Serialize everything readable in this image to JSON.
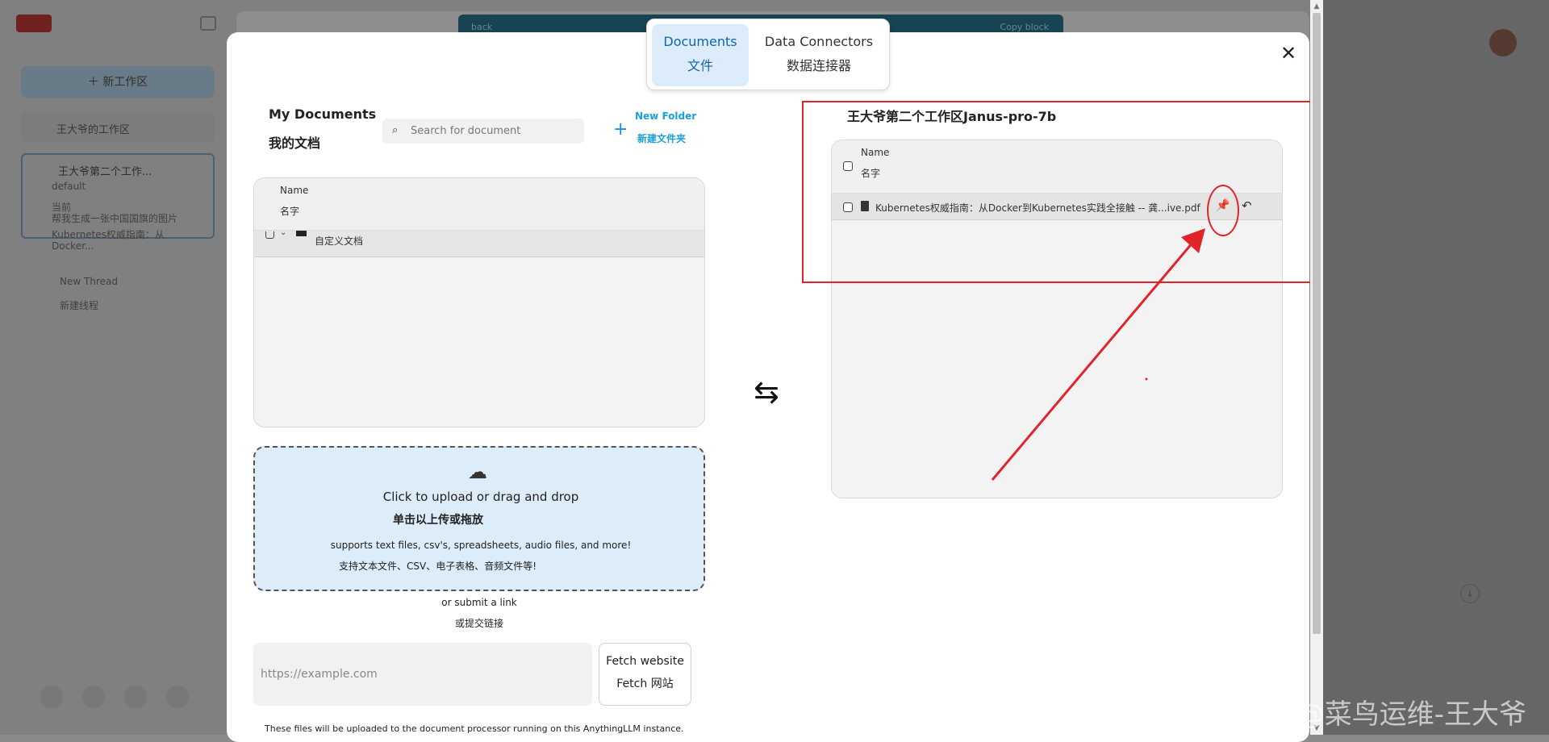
{
  "background_app": {
    "new_workspace": "新工作区",
    "workspace_1": "王大爷的工作区",
    "workspace_2": "王大爷第二个工作...",
    "threads": [
      "default",
      "当前",
      "帮我生成一张中国国旗的图片",
      "Kubernetes权威指南：从Docker..."
    ],
    "new_thread_en": "New Thread",
    "new_thread_zh": "新建线程",
    "top_left": "back",
    "top_right": "Copy block"
  },
  "tabs": {
    "documents_en": "Documents",
    "documents_zh": "文件",
    "connectors_en": "Data Connectors",
    "connectors_zh": "数据连接器"
  },
  "close_glyph": "✕",
  "my_documents": {
    "title_en": "My Documents",
    "title_zh": "我的文档",
    "search_placeholder": "Search for document",
    "new_folder_en": "New Folder",
    "new_folder_zh": "新建文件夹",
    "col_name_en": "Name",
    "col_name_zh": "名字",
    "folder_label": "自定义文档"
  },
  "upload": {
    "title_en": "Click to upload or drag and drop",
    "title_zh": "单击以上传或拖放",
    "supports_en": "supports text files, csv's, spreadsheets, audio files, and more!",
    "supports_zh": "支持文本文件、CSV、电子表格、音频文件等!",
    "or_link_en": "or submit a link",
    "or_link_zh": "或提交链接",
    "url_placeholder": "https://example.com",
    "fetch_en": "Fetch website",
    "fetch_zh": "Fetch 网站",
    "footnote": "These files will be uploaded to the document processor running on this AnythingLLM instance."
  },
  "workspace": {
    "title": "王大爷第二个工作区Janus-pro-7b",
    "col_name_en": "Name",
    "col_name_zh": "名字",
    "file": "Kubernetes权威指南：从Docker到Kubernetes实践全接触 -- 龚...ive.pdf"
  },
  "watermark": "CSDN @菜鸟运维-王大爷",
  "colors": {
    "accent": "#1564a8",
    "annotation_red": "#e0242a",
    "upload_bg": "#dcecf9"
  }
}
